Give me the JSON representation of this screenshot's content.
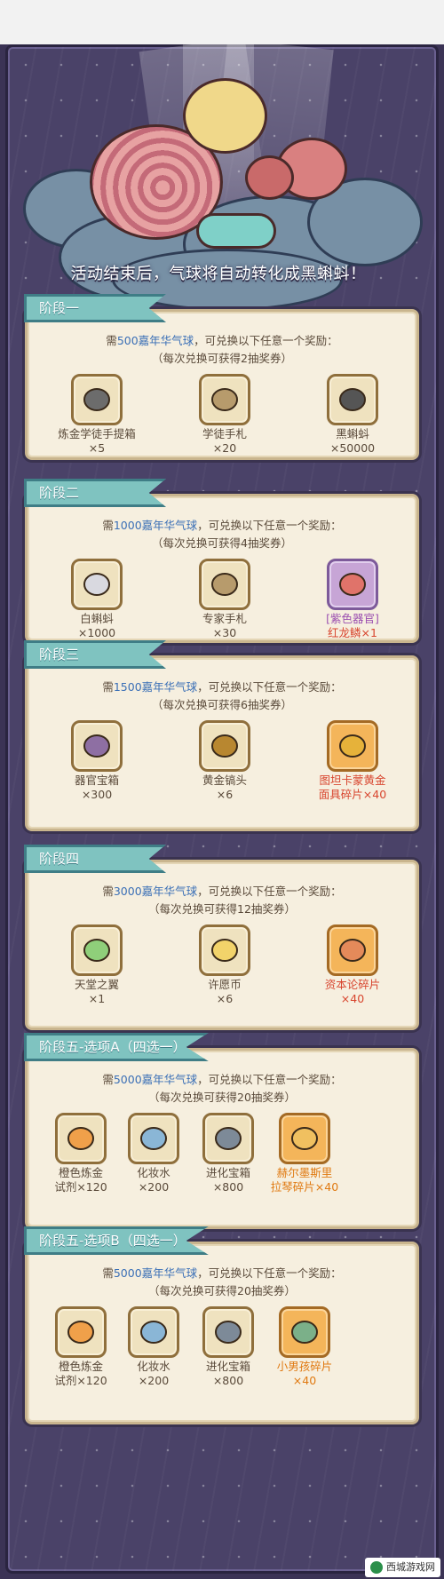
{
  "banner": "活动结束后，气球将自动转化成黑蝌蚪！",
  "stages": [
    {
      "tab": "阶段一",
      "req_prefix": "需",
      "req_amount": "500嘉年华气球",
      "req_suffix": "，可兑换以下任意一个奖励：",
      "note": "（每次兑换可获得2抽奖券）",
      "items": [
        {
          "name": "炼金学徒手提箱",
          "qty": "×5",
          "icon": "briefcase-icon"
        },
        {
          "name": "学徒手札",
          "qty": "×20",
          "icon": "scroll-icon"
        },
        {
          "name": "黑蝌蚪",
          "qty": "×50000",
          "icon": "black-tadpole-icon"
        }
      ]
    },
    {
      "tab": "阶段二",
      "req_prefix": "需",
      "req_amount": "1000嘉年华气球",
      "req_suffix": "，可兑换以下任意一个奖励：",
      "note": "（每次兑换可获得4抽奖券）",
      "items": [
        {
          "name": "白蝌蚪",
          "qty": "×1000",
          "icon": "white-tadpole-icon"
        },
        {
          "name": "专家手札",
          "qty": "×30",
          "icon": "scroll-icon"
        },
        {
          "name": "[紫色器官]",
          "qty": "红龙鳞×1",
          "icon": "dragon-scale-icon"
        }
      ]
    },
    {
      "tab": "阶段三",
      "req_prefix": "需",
      "req_amount": "1500嘉年华气球",
      "req_suffix": "，可兑换以下任意一个奖励：",
      "note": "（每次兑换可获得6抽奖券）",
      "items": [
        {
          "name": "器官宝箱",
          "qty": "×300",
          "icon": "organ-chest-icon"
        },
        {
          "name": "黄金镐头",
          "qty": "×6",
          "icon": "pickaxe-icon"
        },
        {
          "name": "图坦卡蒙黄金",
          "qty": "面具碎片×40",
          "icon": "golden-mask-icon"
        }
      ]
    },
    {
      "tab": "阶段四",
      "req_prefix": "需",
      "req_amount": "3000嘉年华气球",
      "req_suffix": "，可兑换以下任意一个奖励：",
      "note": "（每次兑换可获得12抽奖券）",
      "items": [
        {
          "name": "天堂之翼",
          "qty": "×1",
          "icon": "wing-icon"
        },
        {
          "name": "许愿币",
          "qty": "×6",
          "icon": "wish-coin-icon"
        },
        {
          "name": "资本论碎片",
          "qty": "×40",
          "icon": "book-fragment-icon"
        }
      ]
    },
    {
      "tab": "阶段五-选项A（四选一）",
      "req_prefix": "需",
      "req_amount": "5000嘉年华气球",
      "req_suffix": "，可兑换以下任意一个奖励：",
      "note": "（每次兑换可获得20抽奖券）",
      "items": [
        {
          "name": "橙色炼金",
          "qty": "试剂×120",
          "icon": "potion-icon"
        },
        {
          "name": "化妆水",
          "qty": "×200",
          "icon": "lotion-icon"
        },
        {
          "name": "进化宝箱",
          "qty": "×800",
          "icon": "evolution-chest-icon"
        },
        {
          "name": "赫尔墨斯里",
          "qty": "拉琴碎片×40",
          "icon": "lyre-fragment-icon"
        }
      ]
    },
    {
      "tab": "阶段五-选项B（四选一）",
      "req_prefix": "需",
      "req_amount": "5000嘉年华气球",
      "req_suffix": "，可兑换以下任意一个奖励：",
      "note": "（每次兑换可获得20抽奖券）",
      "items": [
        {
          "name": "橙色炼金",
          "qty": "试剂×120",
          "icon": "potion-icon"
        },
        {
          "name": "化妆水",
          "qty": "×200",
          "icon": "lotion-icon"
        },
        {
          "name": "进化宝箱",
          "qty": "×800",
          "icon": "evolution-chest-icon"
        },
        {
          "name": "小男孩碎片",
          "qty": "×40",
          "icon": "little-boy-fragment-icon"
        }
      ]
    }
  ],
  "watermark": "西城游戏网",
  "colors": {
    "accent_blue": "#3a6fb6",
    "tab_teal": "#7fc3c0",
    "panel": "#f6efdf"
  }
}
